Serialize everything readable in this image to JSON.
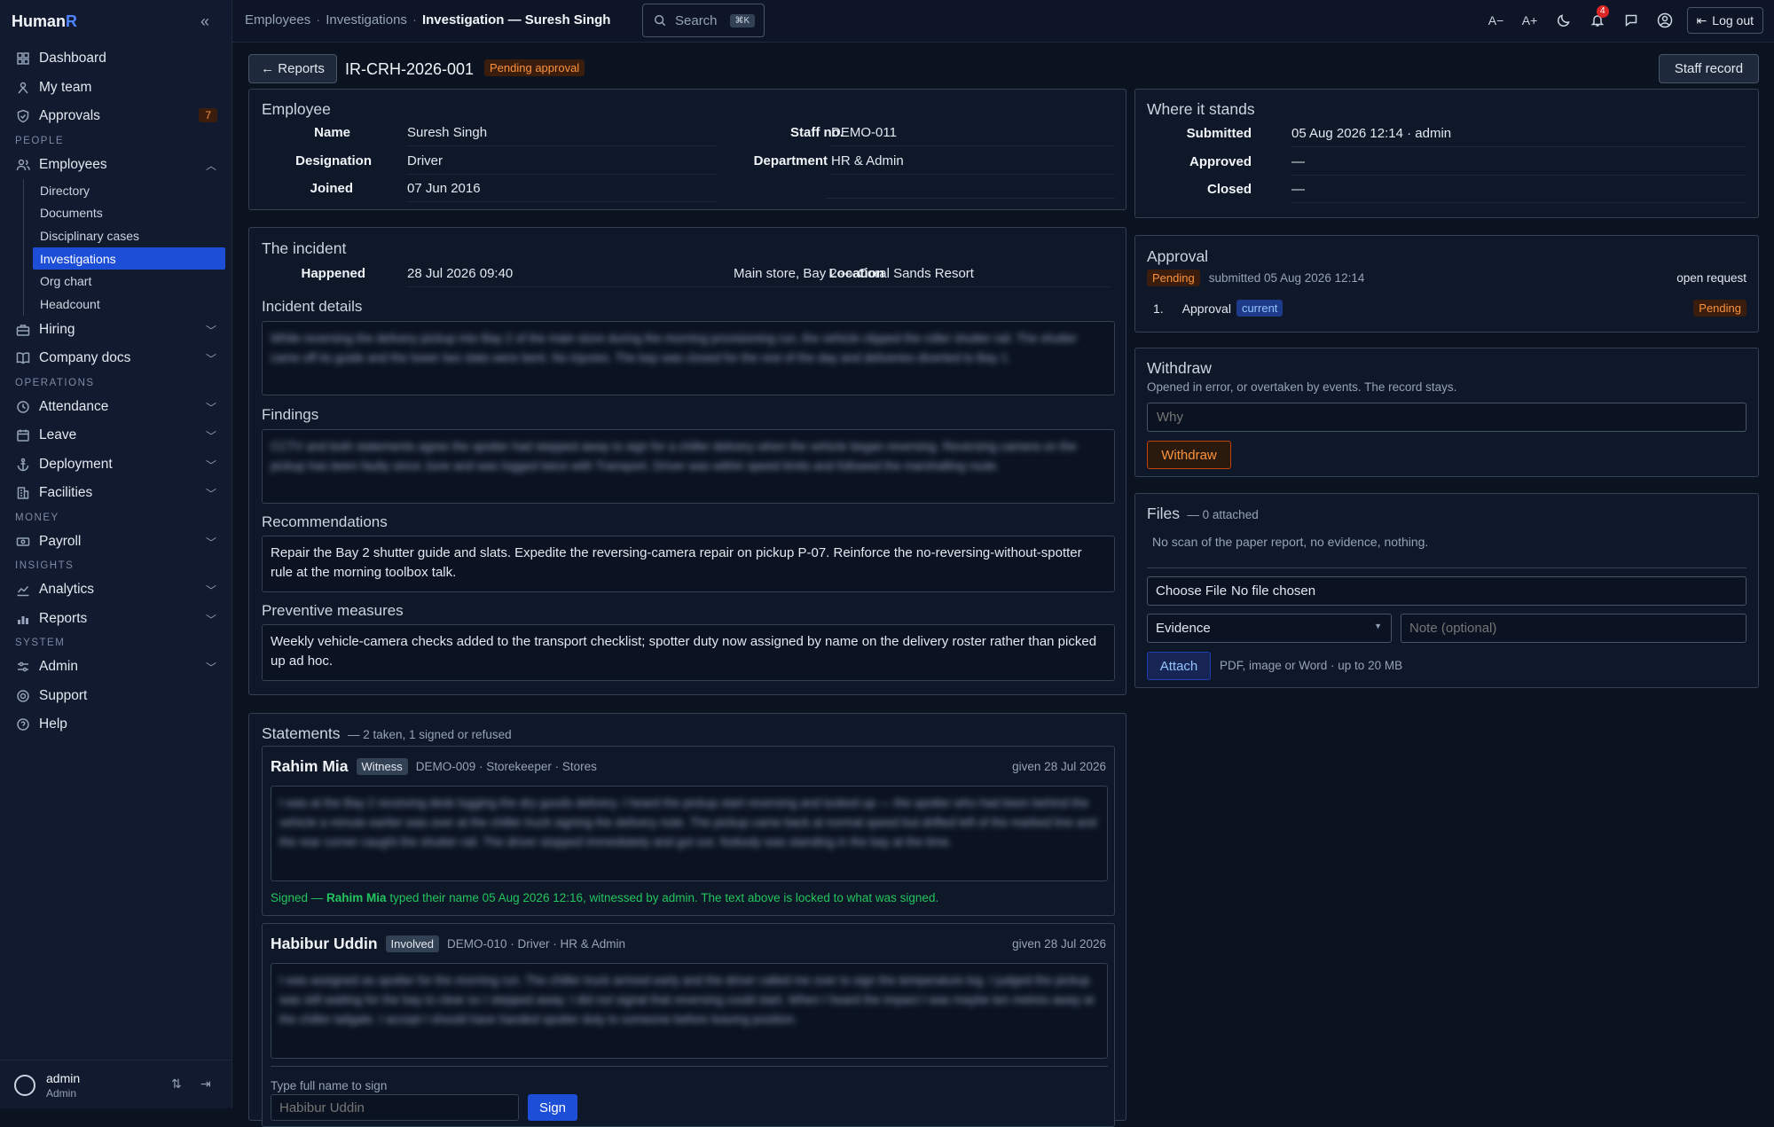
{
  "app": {
    "brand_main": "Human",
    "brand_accent": "R"
  },
  "sidebar": {
    "items_top": [
      {
        "label": "Dashboard",
        "icon": "grid-icon"
      },
      {
        "label": "My team",
        "icon": "team-icon"
      },
      {
        "label": "Approvals",
        "icon": "shield-check-icon",
        "badge": "7"
      }
    ],
    "section_people": "PEOPLE",
    "employees_label": "Employees",
    "employees_sub": [
      "Directory",
      "Documents",
      "Disciplinary cases",
      "Investigations",
      "Org chart",
      "Headcount"
    ],
    "hiring": "Hiring",
    "company_docs": "Company docs",
    "section_operations": "OPERATIONS",
    "attendance": "Attendance",
    "leave": "Leave",
    "deployment": "Deployment",
    "facilities": "Facilities",
    "section_money": "MONEY",
    "payroll": "Payroll",
    "section_insights": "INSIGHTS",
    "analytics": "Analytics",
    "reports": "Reports",
    "section_system": "SYSTEM",
    "admin": "Admin",
    "support": "Support",
    "help": "Help",
    "user_name": "admin",
    "user_role": "Admin"
  },
  "topbar": {
    "crumb1": "Employees",
    "crumb2": "Investigations",
    "crumb3": "Investigation — Suresh Singh",
    "search_label": "Search",
    "search_kbd": "⌘K",
    "font_down": "A−",
    "font_up": "A+",
    "notif_count": "4",
    "logout": "Log out"
  },
  "header": {
    "back_label": "← Reports",
    "record_id": "IR-CRH-2026-001",
    "status": "Pending approval",
    "staff_record": "Staff record"
  },
  "employee": {
    "title": "Employee",
    "name_label": "Name",
    "name": "Suresh Singh",
    "staff_label": "Staff no.",
    "staff": "DEMO-011",
    "designation_label": "Designation",
    "designation": "Driver",
    "department_label": "Department",
    "department": "HR & Admin",
    "joined_label": "Joined",
    "joined": "07 Jun 2016"
  },
  "incident": {
    "title": "The incident",
    "happened_label": "Happened",
    "happened": "28 Jul 2026 09:40",
    "location_label": "Location",
    "location": "Main store, Bay 2 — Coral Sands Resort",
    "details_title": "Incident details",
    "details_text": "While reversing the delivery pickup into Bay 2 of the main store during the morning provisioning run, the vehicle clipped the roller shutter rail. The shutter came off its guide and the lower two slats were bent. No injuries. The bay was closed for the rest of the day and deliveries diverted to Bay 1.",
    "findings_title": "Findings",
    "findings_text": "CCTV and both statements agree the spotter had stepped away to sign for a chiller delivery when the vehicle began reversing. Reversing camera on the pickup has been faulty since June and was logged twice with Transport. Driver was within speed limits and followed the marshalling route.",
    "recs_title": "Recommendations",
    "recs_text": "Repair the Bay 2 shutter guide and slats. Expedite the reversing-camera repair on pickup P-07. Reinforce the no-reversing-without-spotter rule at the morning toolbox talk.",
    "prev_title": "Preventive measures",
    "prev_text": "Weekly vehicle-camera checks added to the transport checklist; spotter duty now assigned by name on the delivery roster rather than picked up ad hoc."
  },
  "statements": {
    "title": "Statements",
    "summary": "— 2 taken, 1 signed or refused",
    "items": [
      {
        "name": "Rahim Mia",
        "role": "Witness",
        "meta": "DEMO-009 · Storekeeper · Stores",
        "given": "given 28 Jul 2026",
        "text": "I was at the Bay 2 receiving desk logging the dry goods delivery. I heard the pickup start reversing and looked up — the spotter who had been behind the vehicle a minute earlier was over at the chiller truck signing the delivery note. The pickup came back at normal speed but drifted left of the marked line and the rear corner caught the shutter rail. The driver stopped immediately and got out. Nobody was standing in the bay at the time.",
        "signed_prefix": "Signed — ",
        "signed_name": "Rahim Mia",
        "signed_suffix": " typed their name 05 Aug 2026 12:16, witnessed by admin. The text above is locked to what was signed."
      },
      {
        "name": "Habibur Uddin",
        "role": "Involved",
        "meta": "DEMO-010 · Driver · HR & Admin",
        "given": "given 28 Jul 2026",
        "text": "I was assigned as spotter for the morning run. The chiller truck arrived early and the driver called me over to sign the temperature log. I judged the pickup was still waiting for the bay to clear so I stepped away. I did not signal that reversing could start. When I heard the impact I was maybe ten metres away at the chiller tailgate. I accept I should have handed spotter duty to someone before leaving position.",
        "sign_label": "Type full name to sign",
        "sign_placeholder": "Habibur Uddin",
        "sign_button": "Sign"
      }
    ]
  },
  "where": {
    "title": "Where it stands",
    "submitted_label": "Submitted",
    "submitted": "05 Aug 2026 12:14 · admin",
    "approved_label": "Approved",
    "approved": "—",
    "closed_label": "Closed",
    "closed": "—"
  },
  "approval": {
    "title": "Approval",
    "status": "Pending",
    "submitted": "submitted 05 Aug 2026 12:14",
    "open_request": "open request",
    "step_no": "1.",
    "step_name": "Approval",
    "step_tag": "current",
    "step_status": "Pending"
  },
  "withdraw": {
    "title": "Withdraw",
    "desc": "Opened in error, or overtaken by events. The record stays.",
    "placeholder": "Why",
    "button": "Withdraw"
  },
  "files": {
    "title": "Files",
    "count": "— 0 attached",
    "empty": "No scan of the paper report, no evidence, nothing.",
    "choose": "Choose File",
    "no_file": "No file chosen",
    "type": "Evidence",
    "note_placeholder": "Note (optional)",
    "attach": "Attach",
    "hint": "PDF, image or Word · up to 20 MB"
  },
  "colors": {
    "accent": "#1d4ed8",
    "warning": "#fb923c",
    "success": "#22c55e",
    "bg": "#0b1220"
  }
}
